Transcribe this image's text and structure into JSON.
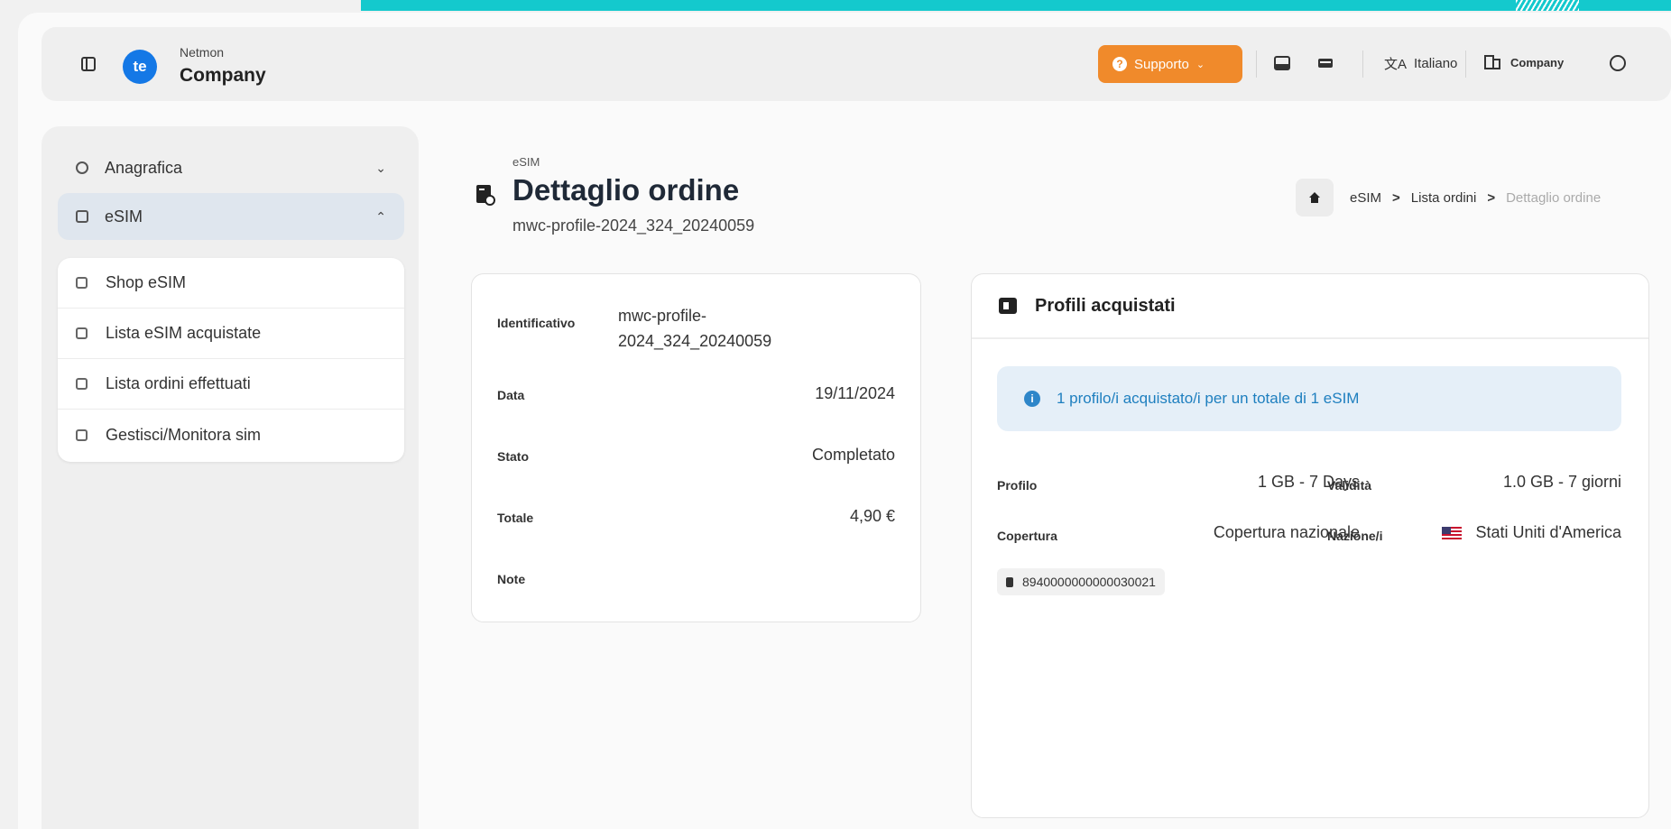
{
  "app": {
    "brand_small": "Netmon",
    "brand_name": "Company",
    "logo_text": "te"
  },
  "header": {
    "support_label": "Supporto",
    "language_label": "Italiano",
    "company_label": "Company"
  },
  "sidebar": {
    "items": [
      {
        "label": "Anagrafica",
        "icon": "database-icon",
        "chevron": "⌄"
      },
      {
        "label": "eSIM",
        "icon": "sim-icon",
        "chevron": "⌃"
      }
    ],
    "submenu": [
      {
        "label": "Shop eSIM",
        "icon": "shop-icon"
      },
      {
        "label": "Lista eSIM acquistate",
        "icon": "list-icon"
      },
      {
        "label": "Lista ordini effettuati",
        "icon": "orders-icon"
      },
      {
        "label": "Gestisci/Monitora sim",
        "icon": "external-link-icon"
      }
    ]
  },
  "page": {
    "section": "eSIM",
    "title": "Dettaglio ordine",
    "subtitle": "mwc-profile-2024_324_20240059"
  },
  "breadcrumb": {
    "item1": "eSIM",
    "item2": "Lista ordini",
    "current": "Dettaglio ordine",
    "separator": ">"
  },
  "order": {
    "id_label": "Identificativo",
    "id_value": "mwc-profile-2024_324_20240059",
    "date_label": "Data",
    "date_value": "19/11/2024",
    "status_label": "Stato",
    "status_value": "Completato",
    "total_label": "Totale",
    "total_value": "4,90 €",
    "notes_label": "Note",
    "notes_value": ""
  },
  "profiles": {
    "title": "Profili acquistati",
    "info": "1 profilo/i acquistato/i per un totale di 1 eSIM",
    "profile_label": "Profilo",
    "profile_value": "1 GB - 7 Days",
    "validity_label": "Validità",
    "validity_value": "1.0 GB - 7 giorni",
    "coverage_label": "Copertura",
    "coverage_value": "Copertura nazionale",
    "country_label": "Nazione/i",
    "country_value": "Stati Uniti d'America",
    "iccid": "8940000000000030021"
  },
  "colors": {
    "accent": "#f08a2b",
    "brand": "#1478e6",
    "teal": "#14c9cd",
    "info": "#1e7fbf"
  }
}
